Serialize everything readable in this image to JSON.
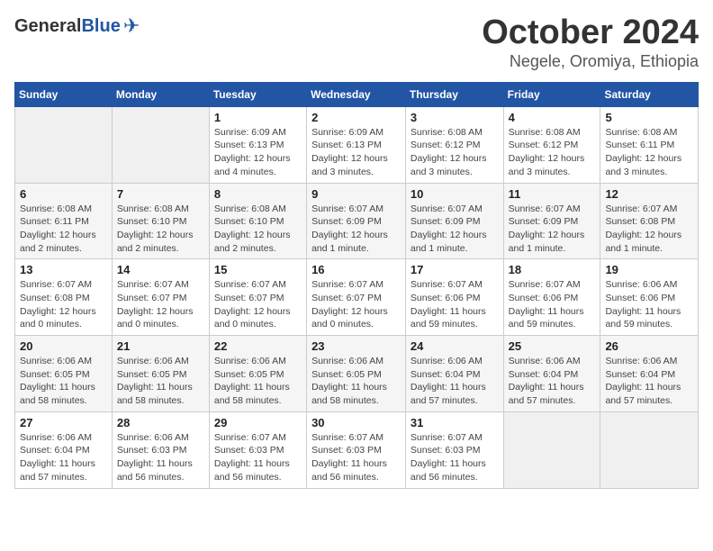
{
  "header": {
    "logo_general": "General",
    "logo_blue": "Blue",
    "month_title": "October 2024",
    "location": "Negele, Oromiya, Ethiopia"
  },
  "weekdays": [
    "Sunday",
    "Monday",
    "Tuesday",
    "Wednesday",
    "Thursday",
    "Friday",
    "Saturday"
  ],
  "weeks": [
    [
      {
        "day": "",
        "empty": true
      },
      {
        "day": "",
        "empty": true
      },
      {
        "day": "1",
        "sunrise": "6:09 AM",
        "sunset": "6:13 PM",
        "daylight": "12 hours and 4 minutes."
      },
      {
        "day": "2",
        "sunrise": "6:09 AM",
        "sunset": "6:13 PM",
        "daylight": "12 hours and 3 minutes."
      },
      {
        "day": "3",
        "sunrise": "6:08 AM",
        "sunset": "6:12 PM",
        "daylight": "12 hours and 3 minutes."
      },
      {
        "day": "4",
        "sunrise": "6:08 AM",
        "sunset": "6:12 PM",
        "daylight": "12 hours and 3 minutes."
      },
      {
        "day": "5",
        "sunrise": "6:08 AM",
        "sunset": "6:11 PM",
        "daylight": "12 hours and 3 minutes."
      }
    ],
    [
      {
        "day": "6",
        "sunrise": "6:08 AM",
        "sunset": "6:11 PM",
        "daylight": "12 hours and 2 minutes."
      },
      {
        "day": "7",
        "sunrise": "6:08 AM",
        "sunset": "6:10 PM",
        "daylight": "12 hours and 2 minutes."
      },
      {
        "day": "8",
        "sunrise": "6:08 AM",
        "sunset": "6:10 PM",
        "daylight": "12 hours and 2 minutes."
      },
      {
        "day": "9",
        "sunrise": "6:07 AM",
        "sunset": "6:09 PM",
        "daylight": "12 hours and 1 minute."
      },
      {
        "day": "10",
        "sunrise": "6:07 AM",
        "sunset": "6:09 PM",
        "daylight": "12 hours and 1 minute."
      },
      {
        "day": "11",
        "sunrise": "6:07 AM",
        "sunset": "6:09 PM",
        "daylight": "12 hours and 1 minute."
      },
      {
        "day": "12",
        "sunrise": "6:07 AM",
        "sunset": "6:08 PM",
        "daylight": "12 hours and 1 minute."
      }
    ],
    [
      {
        "day": "13",
        "sunrise": "6:07 AM",
        "sunset": "6:08 PM",
        "daylight": "12 hours and 0 minutes."
      },
      {
        "day": "14",
        "sunrise": "6:07 AM",
        "sunset": "6:07 PM",
        "daylight": "12 hours and 0 minutes."
      },
      {
        "day": "15",
        "sunrise": "6:07 AM",
        "sunset": "6:07 PM",
        "daylight": "12 hours and 0 minutes."
      },
      {
        "day": "16",
        "sunrise": "6:07 AM",
        "sunset": "6:07 PM",
        "daylight": "12 hours and 0 minutes."
      },
      {
        "day": "17",
        "sunrise": "6:07 AM",
        "sunset": "6:06 PM",
        "daylight": "11 hours and 59 minutes."
      },
      {
        "day": "18",
        "sunrise": "6:07 AM",
        "sunset": "6:06 PM",
        "daylight": "11 hours and 59 minutes."
      },
      {
        "day": "19",
        "sunrise": "6:06 AM",
        "sunset": "6:06 PM",
        "daylight": "11 hours and 59 minutes."
      }
    ],
    [
      {
        "day": "20",
        "sunrise": "6:06 AM",
        "sunset": "6:05 PM",
        "daylight": "11 hours and 58 minutes."
      },
      {
        "day": "21",
        "sunrise": "6:06 AM",
        "sunset": "6:05 PM",
        "daylight": "11 hours and 58 minutes."
      },
      {
        "day": "22",
        "sunrise": "6:06 AM",
        "sunset": "6:05 PM",
        "daylight": "11 hours and 58 minutes."
      },
      {
        "day": "23",
        "sunrise": "6:06 AM",
        "sunset": "6:05 PM",
        "daylight": "11 hours and 58 minutes."
      },
      {
        "day": "24",
        "sunrise": "6:06 AM",
        "sunset": "6:04 PM",
        "daylight": "11 hours and 57 minutes."
      },
      {
        "day": "25",
        "sunrise": "6:06 AM",
        "sunset": "6:04 PM",
        "daylight": "11 hours and 57 minutes."
      },
      {
        "day": "26",
        "sunrise": "6:06 AM",
        "sunset": "6:04 PM",
        "daylight": "11 hours and 57 minutes."
      }
    ],
    [
      {
        "day": "27",
        "sunrise": "6:06 AM",
        "sunset": "6:04 PM",
        "daylight": "11 hours and 57 minutes."
      },
      {
        "day": "28",
        "sunrise": "6:06 AM",
        "sunset": "6:03 PM",
        "daylight": "11 hours and 56 minutes."
      },
      {
        "day": "29",
        "sunrise": "6:07 AM",
        "sunset": "6:03 PM",
        "daylight": "11 hours and 56 minutes."
      },
      {
        "day": "30",
        "sunrise": "6:07 AM",
        "sunset": "6:03 PM",
        "daylight": "11 hours and 56 minutes."
      },
      {
        "day": "31",
        "sunrise": "6:07 AM",
        "sunset": "6:03 PM",
        "daylight": "11 hours and 56 minutes."
      },
      {
        "day": "",
        "empty": true
      },
      {
        "day": "",
        "empty": true
      }
    ]
  ]
}
